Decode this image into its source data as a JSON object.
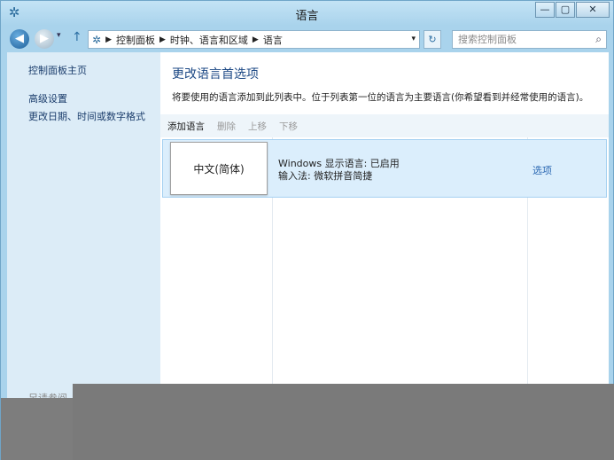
{
  "window": {
    "title": "语言"
  },
  "titlebar": {
    "minimize": "—",
    "maximize": "▢",
    "close": "✕"
  },
  "nav": {
    "back_glyph": "◀",
    "forward_glyph": "▶",
    "dropdown_glyph": "▾",
    "up_glyph": "↑",
    "breadcrumb": [
      "控制面板",
      "时钟、语言和区域",
      "语言"
    ],
    "address_dropdown": "▾",
    "refresh_glyph": "↻",
    "search_placeholder": "搜索控制面板",
    "search_icon": "⌕"
  },
  "sidebar": {
    "home": "控制面板主页",
    "advanced": "高级设置",
    "datetime": "更改日期、时间或数字格式",
    "see_also": "另请参阅"
  },
  "main": {
    "title": "更改语言首选项",
    "description": "将要使用的语言添加到此列表中。位于列表第一位的语言为主要语言(你希望看到并经常使用的语言)。"
  },
  "toolbar": {
    "add": "添加语言",
    "delete": "删除",
    "move_up": "上移",
    "move_down": "下移"
  },
  "languages": [
    {
      "name": "中文(简体)",
      "display_language": "Windows 显示语言: 已启用",
      "input_method": "输入法: 微软拼音简捷",
      "options": "选项"
    }
  ],
  "colors": {
    "window_frame": "#a9d3ec",
    "sidebar_bg": "#dcecf7",
    "title_text": "#1e4a86",
    "link": "#2c69b3",
    "selected_row": "#dbeefc"
  }
}
